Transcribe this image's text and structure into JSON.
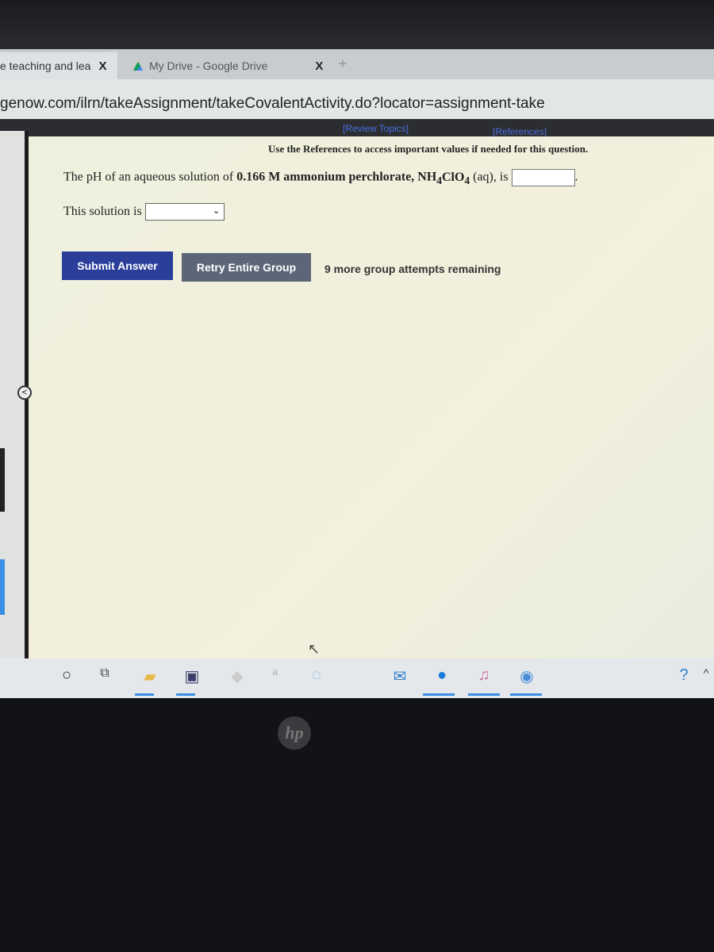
{
  "browser": {
    "tabs": [
      {
        "label": "e teaching and lea",
        "close": "X"
      },
      {
        "label": "My Drive - Google Drive",
        "close": "X"
      }
    ],
    "new_tab": "+",
    "address": "genow.com/ilrn/takeAssignment/takeCovalentActivity.do?locator=assignment-take"
  },
  "page": {
    "review_topics": "[Review Topics]",
    "references": "[References]",
    "note": "Use the References to access important values if needed for this question.",
    "question_pre": "The pH of an aqueous solution of ",
    "question_bold": "0.166 M ammonium perchlorate, NH",
    "sub4a": "4",
    "clo": "ClO",
    "sub4b": "4",
    "question_post": " (aq), is",
    "answer_value": "",
    "period": ".",
    "solution_label": "This solution is",
    "solution_value": "",
    "submit": "Submit Answer",
    "retry": "Retry Entire Group",
    "remaining": "9 more group attempts remaining"
  },
  "taskbar": {
    "icons": [
      "cortana-icon",
      "task-view-icon",
      "file-explorer-icon",
      "store-icon",
      "app-icon",
      "app-icon",
      "app-icon",
      "mail-icon",
      "edge-icon",
      "itunes-icon",
      "chrome-icon",
      "help-icon",
      "chevron-up-icon"
    ]
  },
  "bezel": {
    "logo": "hp"
  }
}
